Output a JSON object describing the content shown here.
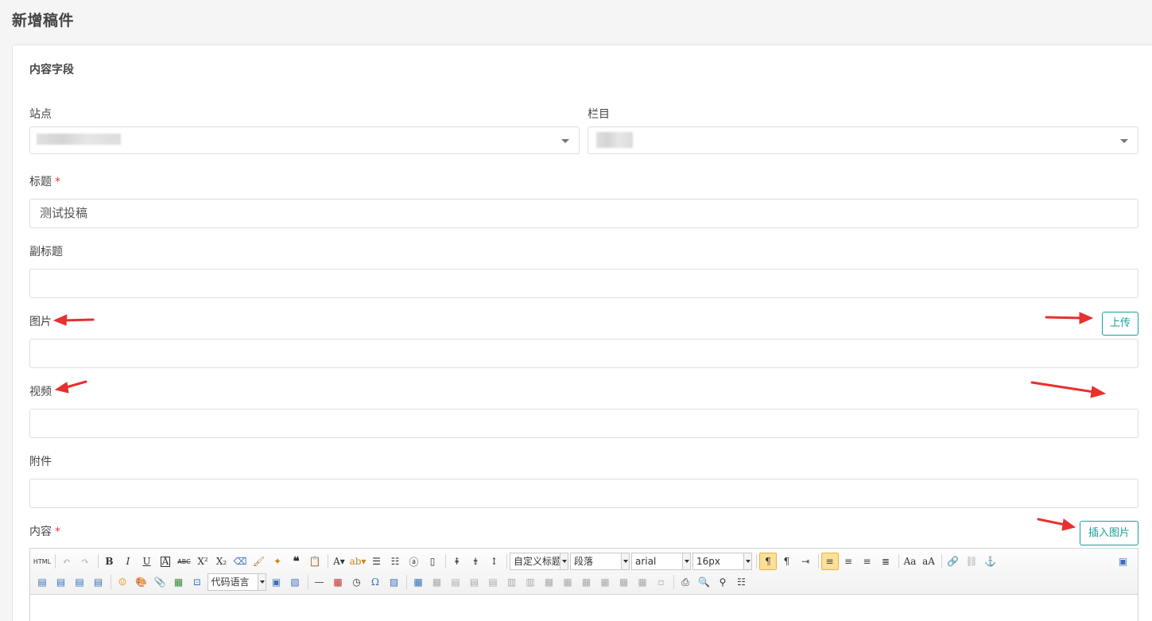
{
  "page": {
    "title": "新增稿件"
  },
  "form": {
    "section_title": "内容字段",
    "site": {
      "label": "站点"
    },
    "column": {
      "label": "栏目"
    },
    "title_field": {
      "label": "标题",
      "required_mark": "*",
      "value": "测试投稿"
    },
    "subtitle": {
      "label": "副标题",
      "value": ""
    },
    "image": {
      "label": "图片",
      "value": "",
      "upload_label": "上传"
    },
    "video": {
      "label": "视频",
      "value": ""
    },
    "attachment": {
      "label": "附件",
      "value": ""
    },
    "content": {
      "label": "内容",
      "required_mark": "*",
      "insert_image_label": "插入图片"
    }
  },
  "editor": {
    "html_label": "HTML",
    "custom_heading": "自定义标题",
    "paragraph": "段落",
    "font_family": "arial",
    "font_size": "16px",
    "code_language": "代码语言",
    "accent_color": "#1aa094",
    "arrow_color": "#e8302e"
  }
}
